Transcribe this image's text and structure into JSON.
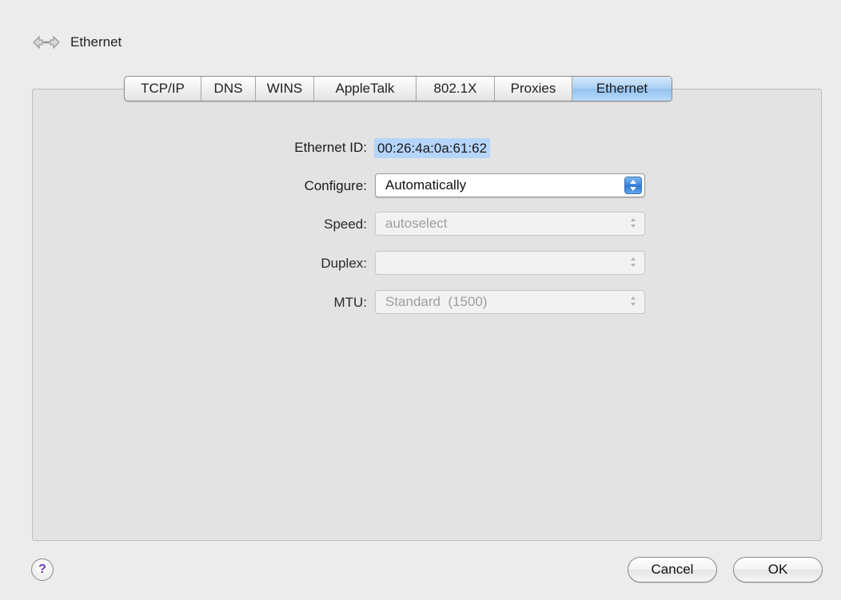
{
  "header": {
    "title": "Ethernet",
    "icon": "ethernet-icon"
  },
  "tabs": [
    {
      "label": "TCP/IP",
      "active": false
    },
    {
      "label": "DNS",
      "active": false
    },
    {
      "label": "WINS",
      "active": false
    },
    {
      "label": "AppleTalk",
      "active": false
    },
    {
      "label": "802.1X",
      "active": false
    },
    {
      "label": "Proxies",
      "active": false
    },
    {
      "label": "Ethernet",
      "active": true
    }
  ],
  "form": {
    "ethernet_id_label": "Ethernet ID:",
    "ethernet_id_value": "00:26:4a:0a:61:62",
    "configure_label": "Configure:",
    "configure_value": "Automatically",
    "speed_label": "Speed:",
    "speed_value": "autoselect",
    "duplex_label": "Duplex:",
    "duplex_value": "",
    "mtu_label": "MTU:",
    "mtu_value": "Standard  (1500)"
  },
  "buttons": {
    "help_glyph": "?",
    "cancel_label": "Cancel",
    "ok_label": "OK"
  },
  "colors": {
    "accent": "#3b86de",
    "selection_highlight": "#b5d5fb",
    "help_icon": "#6a3bb8"
  }
}
